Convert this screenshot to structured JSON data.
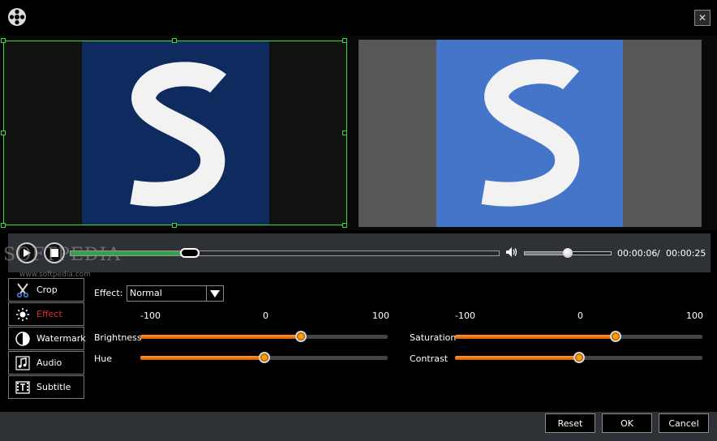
{
  "toolbar": {
    "close_symbol": "✕"
  },
  "player": {
    "current_time": "00:00:06",
    "separator": "/",
    "total_time": "00:00:25",
    "progress_fraction": 0.28,
    "volume_fraction": 0.5
  },
  "watermark": {
    "text": "SOFTPEDIA",
    "url": "www.softpedia.com"
  },
  "sidebar": {
    "items": [
      {
        "label": "Crop",
        "icon": "scissors-icon",
        "active": false
      },
      {
        "label": "Effect",
        "icon": "sun-icon",
        "active": true
      },
      {
        "label": "Watermark",
        "icon": "watermark-icon",
        "active": false
      },
      {
        "label": "Audio",
        "icon": "music-note-icon",
        "active": false
      },
      {
        "label": "Subtitle",
        "icon": "subtitle-icon",
        "active": false
      }
    ]
  },
  "effect": {
    "label": "Effect:",
    "selected": "Normal"
  },
  "scale": {
    "min": "-100",
    "mid": "0",
    "max": "100"
  },
  "adjustments": {
    "brightness": {
      "label": "Brightness",
      "value": 30
    },
    "hue": {
      "label": "Hue",
      "value": 0
    },
    "saturation": {
      "label": "Saturation",
      "value": 30
    },
    "contrast": {
      "label": "Contrast",
      "value": 0
    }
  },
  "buttons": {
    "reset": "Reset",
    "ok": "OK",
    "cancel": "Cancel"
  },
  "colors": {
    "accent": "#ff8a00",
    "active_tab": "#e0282b",
    "crop_border": "#3ae03a",
    "progress": "#39a04a"
  }
}
